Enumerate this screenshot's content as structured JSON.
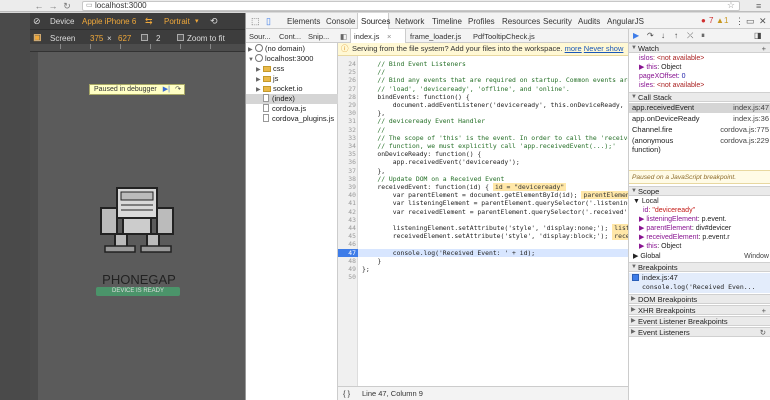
{
  "browser": {
    "url": "localhost:3000",
    "back_icon": "back-arrow-icon",
    "forward_icon": "forward-arrow-icon",
    "reload_icon": "reload-icon"
  },
  "device_toolbar": {
    "device_label": "Device",
    "device_value": "Apple iPhone 6",
    "orientation_label": "Portrait",
    "screen_label": "Screen",
    "width": "375",
    "height": "627",
    "dpr": "2",
    "zoom_label": "Zoom to fit"
  },
  "page": {
    "paused_text": "Paused in debugger",
    "app_title": "PHONEGAP",
    "status_text": "DEVICE IS READY"
  },
  "devtools_tabs": [
    "Elements",
    "Console",
    "Sources",
    "Network",
    "Timeline",
    "Profiles",
    "Resources",
    "Security",
    "Audits",
    "AngularJS"
  ],
  "error_count": "7",
  "warn_count": "1",
  "navigator": {
    "tabs": [
      "Sour...",
      "Cont...",
      "Snip..."
    ],
    "tree": [
      {
        "label": "(no domain)",
        "kind": "globe",
        "indent": 0,
        "tri": "▶"
      },
      {
        "label": "localhost:3000",
        "kind": "globe",
        "indent": 0,
        "tri": "▼"
      },
      {
        "label": "css",
        "kind": "folder",
        "indent": 1,
        "tri": "▶"
      },
      {
        "label": "js",
        "kind": "folder",
        "indent": 1,
        "tri": "▶"
      },
      {
        "label": "socket.io",
        "kind": "folder",
        "indent": 1,
        "tri": "▶"
      },
      {
        "label": "(index)",
        "kind": "file",
        "indent": 1,
        "tri": "",
        "selected": true
      },
      {
        "label": "cordova.js",
        "kind": "file",
        "indent": 1,
        "tri": ""
      },
      {
        "label": "cordova_plugins.js",
        "kind": "file",
        "indent": 1,
        "tri": ""
      }
    ]
  },
  "editor": {
    "tabs": [
      "index.js",
      "frame_loader.js",
      "PdfTooltipCheck.js"
    ],
    "infobar_text": "Serving from the file system? Add your files into the workspace.",
    "infobar_more": "more",
    "infobar_never": "Never show",
    "status": "Line 47, Column 9",
    "lines": [
      {
        "n": "24",
        "text": "    // Bind Event Listeners",
        "cls": "comment"
      },
      {
        "n": "25",
        "text": "    //",
        "cls": "comment"
      },
      {
        "n": "26",
        "text": "    // Bind any events that are required on startup. Common events are:",
        "cls": "comment"
      },
      {
        "n": "27",
        "text": "    // 'load', 'deviceready', 'offline', and 'online'.",
        "cls": "comment"
      },
      {
        "n": "28",
        "text": "    bindEvents: function() {",
        "cls": ""
      },
      {
        "n": "29",
        "text": "        document.addEventListener('deviceready', this.onDeviceReady, fals",
        "cls": ""
      },
      {
        "n": "30",
        "text": "    },",
        "cls": ""
      },
      {
        "n": "31",
        "text": "    // deviceready Event Handler",
        "cls": "comment"
      },
      {
        "n": "32",
        "text": "    //",
        "cls": "comment"
      },
      {
        "n": "33",
        "text": "    // The scope of 'this' is the event. In order to call the 'receivedEv",
        "cls": "comment"
      },
      {
        "n": "34",
        "text": "    // function, we must explicitly call 'app.receivedEvent(...);'",
        "cls": "comment"
      },
      {
        "n": "35",
        "text": "    onDeviceReady: function() {",
        "cls": ""
      },
      {
        "n": "36",
        "text": "        app.receivedEvent('deviceready');",
        "cls": ""
      },
      {
        "n": "37",
        "text": "    },",
        "cls": ""
      },
      {
        "n": "38",
        "text": "    // Update DOM on a Received Event",
        "cls": "comment"
      },
      {
        "n": "39",
        "text": "    receivedEvent: function(id) {",
        "cls": "",
        "hint": "id = \"deviceready\""
      },
      {
        "n": "40",
        "text": "        var parentElement = document.getElementById(id);",
        "cls": "",
        "hint": "parentElement ="
      },
      {
        "n": "41",
        "text": "        var listeningElement = parentElement.querySelector('.listening');",
        "cls": "",
        "hint": "l"
      },
      {
        "n": "42",
        "text": "        var receivedElement = parentElement.querySelector('.received');",
        "cls": "",
        "hint": ""
      },
      {
        "n": "43",
        "text": "",
        "cls": ""
      },
      {
        "n": "44",
        "text": "        listeningElement.setAttribute('style', 'display:none;');",
        "cls": "",
        "hint": "listen"
      },
      {
        "n": "45",
        "text": "        receivedElement.setAttribute('style', 'display:block;');",
        "cls": "",
        "hint": "receive"
      },
      {
        "n": "46",
        "text": "",
        "cls": ""
      },
      {
        "n": "47",
        "text": "        console.log('Received Event: ' + id);",
        "cls": "exec"
      },
      {
        "n": "48",
        "text": "    }",
        "cls": ""
      },
      {
        "n": "49",
        "text": "};",
        "cls": ""
      },
      {
        "n": "50",
        "text": "",
        "cls": ""
      }
    ]
  },
  "sidebar": {
    "watch_label": "Watch",
    "watch_rows": [
      {
        "k": "islos",
        "v": ": <not available>"
      },
      {
        "k": "▶ this",
        "v": ": Object"
      },
      {
        "k": "pageXOffset",
        "v": ": 0"
      },
      {
        "k": "isles",
        "v": ": <not available>"
      }
    ],
    "callstack_label": "Call Stack",
    "callstack": [
      {
        "fn": "app.receivedEvent",
        "loc": "index.js:47",
        "selected": true
      },
      {
        "fn": "app.onDeviceReady",
        "loc": "index.js:36"
      },
      {
        "fn": "Channel.fire",
        "loc": "cordova.js:775"
      },
      {
        "fn": "(anonymous",
        "loc": "cordova.js:229"
      },
      {
        "fn": "function)",
        "loc": ""
      }
    ],
    "paused_msg": "Paused on a JavaScript breakpoint.",
    "scope_label": "Scope",
    "local_label": "Local",
    "scope_rows": [
      {
        "k": "id",
        "v": ": \"deviceready\""
      },
      {
        "k": "▶ listeningElement",
        "v": ": p.event."
      },
      {
        "k": "▶ parentElement",
        "v": ": div#devicer"
      },
      {
        "k": "▶ receivedElement",
        "v": ": p.event.r"
      },
      {
        "k": "▶ this",
        "v": ": Object"
      }
    ],
    "global_label": "Global",
    "global_value": "Window",
    "breakpoints_label": "Breakpoints",
    "bp_file": "index.js:47",
    "bp_code": "console.log('Received Even...",
    "dom_bp_label": "DOM Breakpoints",
    "xhr_bp_label": "XHR Breakpoints",
    "listener_bp_label": "Event Listener Breakpoints",
    "listeners_label": "Event Listeners"
  }
}
